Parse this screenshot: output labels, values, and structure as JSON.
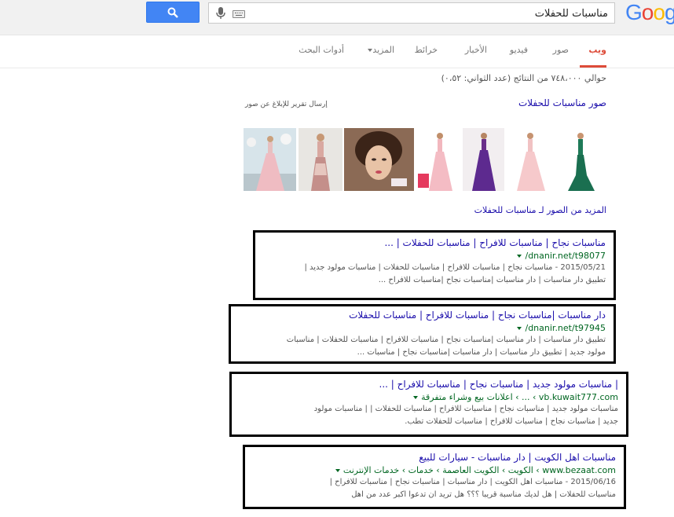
{
  "header": {
    "logo_text": "Google",
    "search_value": "مناسبات للحفلات",
    "search_button_icon": "magnifier-icon"
  },
  "tabs": [
    {
      "label": "ويب",
      "active": true
    },
    {
      "label": "صور",
      "active": false
    },
    {
      "label": "فيديو",
      "active": false
    },
    {
      "label": "الأخبار",
      "active": false
    },
    {
      "label": "خرائط",
      "active": false
    },
    {
      "label": "المزيد",
      "active": false
    },
    {
      "label": "أدوات البحث",
      "active": false
    }
  ],
  "stats": "حوالي ٧٤٨،٠٠٠ من النتائج (عدد الثواني: ٠،٥٢)",
  "images": {
    "title": "صور مناسبات للحفلات",
    "report": "إرسال تقرير للإبلاغ عن صور",
    "more": "المزيد من الصور لـ مناسبات للحفلات"
  },
  "results": [
    {
      "title": "مناسبات نجاح | مناسبات للافراح | مناسبات للحفلات | ...",
      "url": "dnanir.net/t98077/",
      "snippet_1": "2015/05/21 - مناسبات نجاح | مناسبات للافراح | مناسبات للحفلات | مناسبات مولود جديد |",
      "snippet_2": "تطبيق دار مناسبات | دار مناسبات |مناسبات نجاح |مناسبات للافراح ..."
    },
    {
      "title": "دار مناسبات |مناسبات نجاح | مناسبات للافراح | مناسبات للحفلات",
      "url": "dnanir.net/t97945/",
      "snippet_1": "تطبيق دار مناسبات | دار مناسبات |مناسبات نجاح | مناسبات للافراح | مناسبات للحفلات | مناسبات",
      "snippet_2": "مولود جديد | تطبيق دار مناسبات | دار مناسبات |مناسبات نجاح | مناسبات ..."
    },
    {
      "title": "| مناسبات مولود جديد | مناسبات نجاح | مناسبات للافراح | ...",
      "url": "vb.kuwait777.com › ... › اعلانات بيع وشراء متفرقة",
      "snippet_1": "مناسبات مولود جديد | مناسبات نجاح | مناسبات للافراح | مناسبات للحفلات | | مناسبات مولود",
      "snippet_2": "جديد | مناسبات نجاح | مناسبات للافراح | مناسبات للحفلات تطب."
    },
    {
      "title": "مناسبات اهل الكويت | دار مناسبات - سيارات للبيع",
      "url": "www.bezaat.com › الكويت › الكويت العاصمة › خدمات › خدمات الإنترنت",
      "snippet_1": "2015/06/16 - مناسبات اهل الكويت | دار مناسبات | مناسبات نجاح | مناسبات للافراح |",
      "snippet_2": "مناسبات للحفلات | هل لديك مناسبة قريبا ؟؟؟ هل تريد ان تدعوا اكبر عدد من اهل"
    }
  ],
  "colors": {
    "accent": "#dd4b39",
    "link": "#1a0dab",
    "url": "#006621",
    "button": "#4285f4"
  }
}
